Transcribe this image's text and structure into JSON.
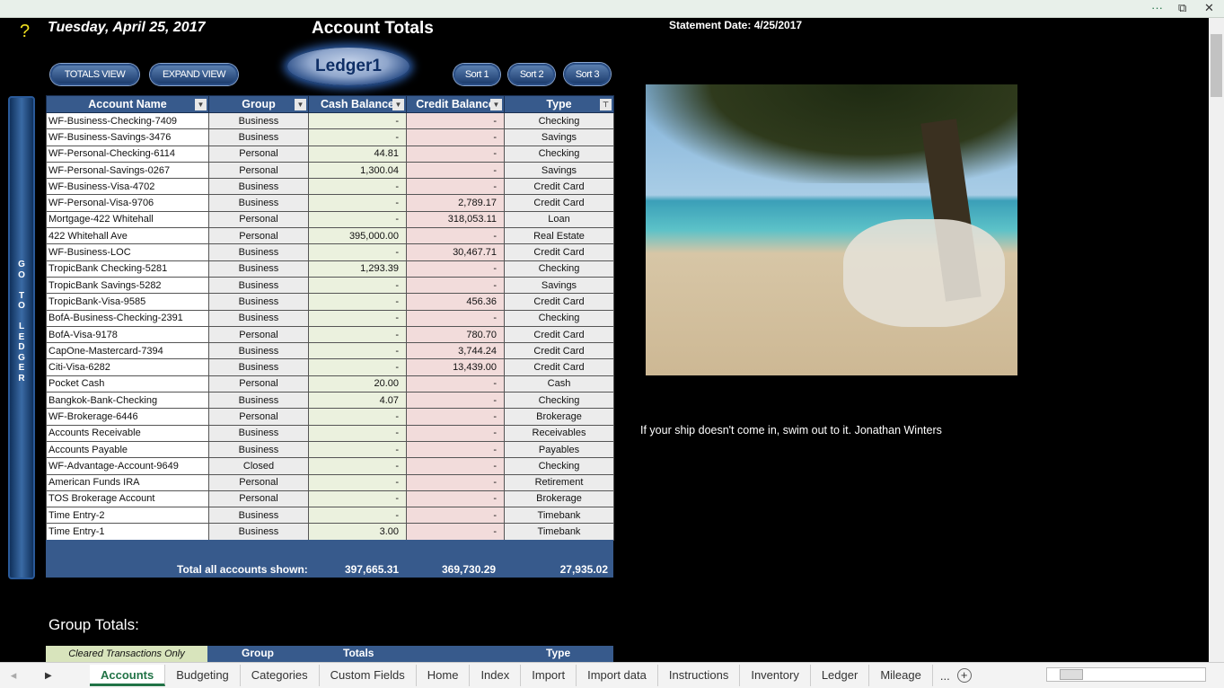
{
  "header": {
    "help": "?",
    "date": "Tuesday, April 25, 2017",
    "title": "Account Totals",
    "statement": "Statement Date:  4/25/2017"
  },
  "buttons": {
    "totals_view": "TOTALS VIEW",
    "expand_view": "EXPAND VIEW",
    "ledger": "Ledger1",
    "sort1": "Sort 1",
    "sort2": "Sort 2",
    "sort3": "Sort 3",
    "goto": [
      "G",
      "O",
      "",
      "T",
      "O",
      "",
      "L",
      "E",
      "D",
      "G",
      "E",
      "R"
    ]
  },
  "table": {
    "columns": [
      "Account Name",
      "Group",
      "Cash Balance",
      "Credit Balance",
      "Type"
    ],
    "rows": [
      [
        "WF-Business-Checking-7409",
        "Business",
        "-",
        "-",
        "Checking"
      ],
      [
        "WF-Business-Savings-3476",
        "Business",
        "-",
        "-",
        "Savings"
      ],
      [
        "WF-Personal-Checking-6114",
        "Personal",
        "44.81",
        "-",
        "Checking"
      ],
      [
        "WF-Personal-Savings-0267",
        "Personal",
        "1,300.04",
        "-",
        "Savings"
      ],
      [
        "WF-Business-Visa-4702",
        "Business",
        "-",
        "-",
        "Credit Card"
      ],
      [
        "WF-Personal-Visa-9706",
        "Business",
        "-",
        "2,789.17",
        "Credit Card"
      ],
      [
        "Mortgage-422 Whitehall",
        "Personal",
        "-",
        "318,053.11",
        "Loan"
      ],
      [
        "422 Whitehall Ave",
        "Personal",
        "395,000.00",
        "-",
        "Real Estate"
      ],
      [
        "WF-Business-LOC",
        "Business",
        "-",
        "30,467.71",
        "Credit Card"
      ],
      [
        "TropicBank Checking-5281",
        "Business",
        "1,293.39",
        "-",
        "Checking"
      ],
      [
        "TropicBank Savings-5282",
        "Business",
        "-",
        "-",
        "Savings"
      ],
      [
        "TropicBank-Visa-9585",
        "Business",
        "-",
        "456.36",
        "Credit Card"
      ],
      [
        "BofA-Business-Checking-2391",
        "Business",
        "-",
        "-",
        "Checking"
      ],
      [
        "BofA-Visa-9178",
        "Personal",
        "-",
        "780.70",
        "Credit Card"
      ],
      [
        "CapOne-Mastercard-7394",
        "Business",
        "-",
        "3,744.24",
        "Credit Card"
      ],
      [
        "Citi-Visa-6282",
        "Business",
        "-",
        "13,439.00",
        "Credit Card"
      ],
      [
        "Pocket Cash",
        "Personal",
        "20.00",
        "-",
        "Cash"
      ],
      [
        "Bangkok-Bank-Checking",
        "Business",
        "4.07",
        "-",
        "Checking"
      ],
      [
        "WF-Brokerage-6446",
        "Personal",
        "-",
        "-",
        "Brokerage"
      ],
      [
        "Accounts Receivable",
        "Business",
        "-",
        "-",
        "Receivables"
      ],
      [
        "Accounts Payable",
        "Business",
        "-",
        "-",
        "Payables"
      ],
      [
        "WF-Advantage-Account-9649",
        "Closed",
        "-",
        "-",
        "Checking"
      ],
      [
        "American Funds IRA",
        "Personal",
        "-",
        "-",
        "Retirement"
      ],
      [
        "TOS Brokerage Account",
        "Personal",
        "-",
        "-",
        "Brokerage"
      ],
      [
        "Time Entry-2",
        "Business",
        "-",
        "-",
        "Timebank"
      ],
      [
        "Time Entry-1",
        "Business",
        "3.00",
        "-",
        "Timebank"
      ]
    ],
    "total_label": "Total all accounts shown:",
    "total_cash": "397,665.31",
    "total_credit": "369,730.29",
    "total_net": "27,935.02"
  },
  "group_totals": {
    "title": "Group Totals:",
    "cleared": "Cleared Transactions Only",
    "group": "Group",
    "totals": "Totals",
    "type": "Type"
  },
  "quote": "If your ship doesn't come in, swim out to it. Jonathan Winters",
  "tabs": [
    "Accounts",
    "Budgeting",
    "Categories",
    "Custom Fields",
    "Home",
    "Index",
    "Import",
    "Import data",
    "Instructions",
    "Inventory",
    "Ledger",
    "Mileage"
  ],
  "tabbar": {
    "more": "...",
    "add": "+"
  }
}
